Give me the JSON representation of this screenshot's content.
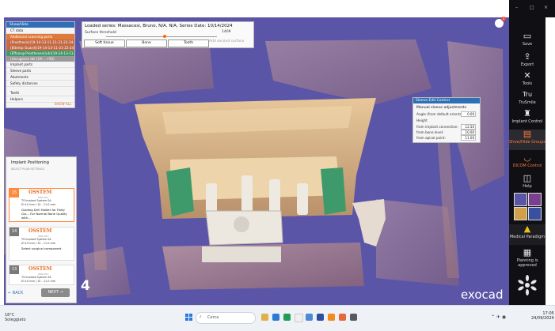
{
  "title_bar": {
    "min": "–",
    "max": "□",
    "close": "×"
  },
  "loaded_series": {
    "title": "Loaded series: Massacesi, Bruno, N/A, N/A, Series Date: 10/14/2024",
    "surface_threshold_label": "Surface threshold",
    "threshold_value": "1409",
    "buttons": [
      "Soft tissue",
      "Bone",
      "Tooth"
    ],
    "add_surface": "Add second surface"
  },
  "show_hide": {
    "header": "Show/Hide",
    "rows": [
      {
        "label": "CT data",
        "style": "g"
      },
      {
        "label": "Additional scanning parts",
        "style": "orange"
      },
      {
        "label": "(Prosthesis)(19-14-13-11-11-21-22-24-25)",
        "style": "orange2"
      },
      {
        "label": "(Bitemp Guard)(19-14-13-11-21-22-24)",
        "style": "orange2"
      },
      {
        "label": "(Effoong-Prostheses)(uti)(19-14-13-11-...)",
        "style": "green"
      },
      {
        "label": "(Unrugeon) del (19-...+50)",
        "style": "grey"
      },
      {
        "label": "Implant parts",
        "style": "g"
      },
      {
        "label": "Sleeve parts",
        "style": "g"
      },
      {
        "label": "Abutments",
        "style": "g"
      },
      {
        "label": "Safety distances",
        "style": "g"
      },
      {
        "label": "Teeth",
        "style": "g"
      },
      {
        "label": "Helpers",
        "style": "g"
      }
    ],
    "hide_all": "SHOW ALL"
  },
  "sleeve_edit": {
    "header": "Sleeve Edit Control",
    "section": "Manual sleeve adjustments",
    "angle_label": "Angle (from default orientation)",
    "angle_value": "0.00",
    "height_label": "Height",
    "rows": [
      {
        "label": "from implant connection:",
        "value": "12.50"
      },
      {
        "label": "from bone level:",
        "value": "10.00"
      },
      {
        "label": "from apical point:",
        "value": "11.00"
      }
    ]
  },
  "implant_panel": {
    "title": "Implant Positioning",
    "tabs": "SELECT    PLAN    SETTINGS",
    "cards": [
      {
        "num": "15",
        "brand": "OSSTEM",
        "brand_sub": "IMPLANT",
        "l1": "TS Implant System SA",
        "l2": "Ø 4.0 mm / 10 - 11.0 mm",
        "l3": "Guiding Drill Holder for Fixity Gui... For Normal Bone Quality with...",
        "active": true
      },
      {
        "num": "14",
        "brand": "OSSTEM",
        "brand_sub": "IMPLANT",
        "l1": "TS Implant System SA",
        "l2": "Ø 4.0 mm / 10 - 11.0 mm",
        "l3": "Select surgical component",
        "active": false
      },
      {
        "num": "13",
        "brand": "OSSTEM",
        "brand_sub": "IMPLANT",
        "l1": "TS Implant System SA",
        "l2": "Ø 4.0 mm / 10 - 11.0 mm",
        "l3": "",
        "active": false
      }
    ],
    "back": "← BACK",
    "next": "NEXT  →"
  },
  "step_number": "4",
  "watermark": "exocad",
  "notification_count": "1",
  "sidebar": [
    {
      "label": "Save",
      "icon": "save-icon",
      "glyph": "▭"
    },
    {
      "label": "Export",
      "icon": "export-icon",
      "glyph": "⇪"
    },
    {
      "label": "Tools",
      "icon": "tools-icon",
      "glyph": "✕"
    },
    {
      "label": "TruSmile",
      "icon": "trusmile-icon",
      "glyph": "Tru"
    },
    {
      "label": "Implant Control",
      "icon": "implant-control-icon",
      "glyph": "♜"
    },
    {
      "label": "Show/Hide Groups",
      "icon": "show-hide-groups-icon",
      "glyph": "▤"
    },
    {
      "label": "DICOM Control",
      "icon": "dicom-control-icon",
      "glyph": "◡"
    },
    {
      "label": "Help",
      "icon": "help-icon",
      "glyph": "◫"
    },
    {
      "label": "Medical Paradigm",
      "icon": "warning-icon",
      "glyph": "▲"
    },
    {
      "label": "Planning is approved",
      "icon": "planning-approved-icon",
      "glyph": "▦"
    }
  ],
  "taskbar": {
    "weather_temp": "18°C",
    "weather_desc": "Soleggiato",
    "search_placeholder": "Cerca",
    "time": "17:05",
    "date": "24/09/2024"
  },
  "colors": {
    "viewport_bg": "#5b55a8",
    "accent_orange": "#ff7a3a",
    "header_blue": "#2f6fb5"
  }
}
